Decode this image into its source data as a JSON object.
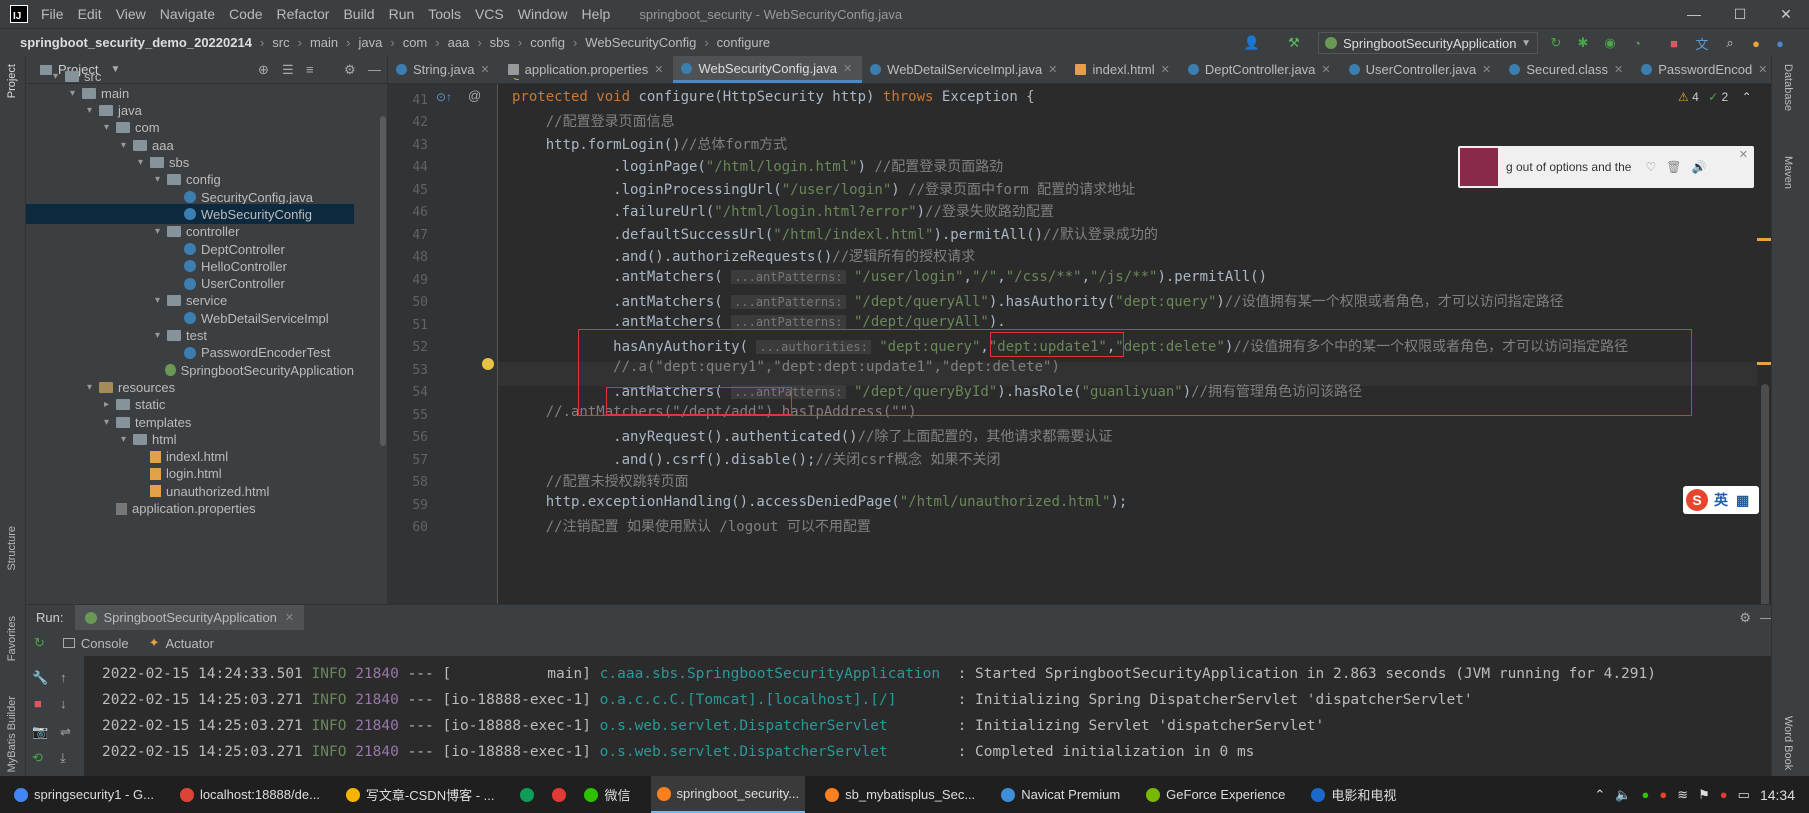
{
  "titlebar": {
    "logo": "IJ",
    "menu": [
      "File",
      "Edit",
      "View",
      "Navigate",
      "Code",
      "Refactor",
      "Build",
      "Run",
      "Tools",
      "VCS",
      "Window",
      "Help"
    ],
    "title": "springboot_security - WebSecurityConfig.java"
  },
  "breadcrumbs": [
    "springboot_security_demo_20220214",
    "src",
    "main",
    "java",
    "com",
    "aaa",
    "sbs",
    "config",
    "WebSecurityConfig",
    "configure"
  ],
  "run_config": "SpringbootSecurityApplication",
  "project_panel": {
    "title": "Project",
    "tree": [
      {
        "label": "src",
        "depth": 1,
        "type": "folder",
        "open": true
      },
      {
        "label": "main",
        "depth": 2,
        "type": "folder",
        "open": true
      },
      {
        "label": "java",
        "depth": 3,
        "type": "folder",
        "open": true
      },
      {
        "label": "com",
        "depth": 4,
        "type": "folder",
        "open": true
      },
      {
        "label": "aaa",
        "depth": 5,
        "type": "folder",
        "open": true
      },
      {
        "label": "sbs",
        "depth": 6,
        "type": "folder",
        "open": true
      },
      {
        "label": "config",
        "depth": 7,
        "type": "folder",
        "open": true
      },
      {
        "label": "SecurityConfig.java",
        "depth": 8,
        "type": "java"
      },
      {
        "label": "WebSecurityConfig",
        "depth": 8,
        "type": "java",
        "selected": true
      },
      {
        "label": "controller",
        "depth": 7,
        "type": "folder",
        "open": true
      },
      {
        "label": "DeptController",
        "depth": 8,
        "type": "java"
      },
      {
        "label": "HelloController",
        "depth": 8,
        "type": "java"
      },
      {
        "label": "UserController",
        "depth": 8,
        "type": "java"
      },
      {
        "label": "service",
        "depth": 7,
        "type": "folder",
        "open": true
      },
      {
        "label": "WebDetailServiceImpl",
        "depth": 8,
        "type": "java"
      },
      {
        "label": "test",
        "depth": 7,
        "type": "folder",
        "open": true
      },
      {
        "label": "PasswordEncoderTest",
        "depth": 8,
        "type": "java"
      },
      {
        "label": "SpringbootSecurityApplication",
        "depth": 7,
        "type": "spring"
      },
      {
        "label": "resources",
        "depth": 3,
        "type": "res",
        "open": true
      },
      {
        "label": "static",
        "depth": 4,
        "type": "folder"
      },
      {
        "label": "templates",
        "depth": 4,
        "type": "folder",
        "open": true
      },
      {
        "label": "html",
        "depth": 5,
        "type": "folder",
        "open": true
      },
      {
        "label": "indexl.html",
        "depth": 6,
        "type": "html"
      },
      {
        "label": "login.html",
        "depth": 6,
        "type": "html"
      },
      {
        "label": "unauthorized.html",
        "depth": 6,
        "type": "html"
      },
      {
        "label": "application.properties",
        "depth": 4,
        "type": "prop"
      }
    ]
  },
  "tabs": [
    {
      "label": "String.java",
      "icon": "java"
    },
    {
      "label": "application.properties",
      "icon": "prop"
    },
    {
      "label": "WebSecurityConfig.java",
      "icon": "java",
      "active": true
    },
    {
      "label": "WebDetailServiceImpl.java",
      "icon": "java"
    },
    {
      "label": "indexl.html",
      "icon": "html"
    },
    {
      "label": "DeptController.java",
      "icon": "java"
    },
    {
      "label": "UserController.java",
      "icon": "java"
    },
    {
      "label": "Secured.class",
      "icon": "java"
    },
    {
      "label": "PasswordEncod",
      "icon": "java"
    }
  ],
  "inspections": {
    "warnings": "4",
    "weak": "2"
  },
  "code_lines": [
    {
      "n": "",
      "html": "<span class=\"ann\">@Override</span>"
    },
    {
      "n": "41",
      "html": "<span class=\"kw\">protected void</span> configure(HttpSecurity http) <span class=\"kw\">throws</span> Exception {"
    },
    {
      "n": "42",
      "html": "    <span class=\"cm\">//配置登录页面信息</span>"
    },
    {
      "n": "43",
      "html": "    http.formLogin()<span class=\"cm\">//总体form方式</span>"
    },
    {
      "n": "44",
      "html": "            .loginPage(<span class=\"str\">\"/html/login.html\"</span>) <span class=\"cm\">//配置登录页面路劲</span>"
    },
    {
      "n": "45",
      "html": "            .loginProcessingUrl(<span class=\"str\">\"/user/login\"</span>) <span class=\"cm\">//登录页面中form 配置的请求地址</span>"
    },
    {
      "n": "46",
      "html": "            .failureUrl(<span class=\"str\">\"/html/login.html?error\"</span>)<span class=\"cm\">//登录失败路劲配置</span>"
    },
    {
      "n": "47",
      "html": "            .defaultSuccessUrl(<span class=\"str\">\"/html/indexl.html\"</span>).permitAll()<span class=\"cm\">//默认登录成功的</span>"
    },
    {
      "n": "48",
      "html": "            .and().authorizeRequests()<span class=\"cm\">//逻辑所有的授权请求</span>"
    },
    {
      "n": "49",
      "html": "            .antMatchers( <span class=\"hint\">...antPatterns:</span> <span class=\"str\">\"/user/login\"</span>,<span class=\"str\">\"/\"</span>,<span class=\"str\">\"/css/**\"</span>,<span class=\"str\">\"/js/**\"</span>).permitAll()"
    },
    {
      "n": "50",
      "html": "            .antMatchers( <span class=\"hint\">...antPatterns:</span> <span class=\"str\">\"/dept/queryAll\"</span>).hasAuthority(<span class=\"str\">\"dept:query\"</span>)<span class=\"cm\">//设值拥有某一个权限或者角色，才可以访问指定路径</span>"
    },
    {
      "n": "51",
      "html": "            .antMatchers( <span class=\"hint\">...antPatterns:</span> <span class=\"str\">\"/dept/queryAll\"</span>)."
    },
    {
      "n": "52",
      "html": "            hasAnyAuthority( <span class=\"hint\">...authorities:</span> <span class=\"str\">\"dept:query\"</span>,<span class=\"str\">\"dept:update1\"</span>,<span class=\"str\">\"dept:delete\"</span>)<span class=\"cm\">//设值拥有多个中的某一个权限或者角色，才可以访问指定路径</span>"
    },
    {
      "n": "53",
      "html": "            <span class=\"cm\">//.a(\"dept:query1\",\"dept:dept:update1\",\"dept:delete\")</span>"
    },
    {
      "n": "54",
      "html": "            .antMatchers( <span class=\"hint\">...antPatterns:</span> <span class=\"str\">\"/dept/queryById\"</span>).hasRole(<span class=\"str\">\"guanliyuan\"</span>)<span class=\"cm\">//拥有管理角色访问该路径</span>"
    },
    {
      "n": "55",
      "html": "    <span class=\"cm\">//.antMatchers(\"/dept/add\").hasIpAddress(\"\")</span>"
    },
    {
      "n": "56",
      "html": "            .anyRequest().authenticated()<span class=\"cm\">//除了上面配置的，其他请求都需要认证</span>"
    },
    {
      "n": "57",
      "html": "            .and().csrf().disable();<span class=\"cm\">//关闭csrf概念 如果不关闭</span>"
    },
    {
      "n": "58",
      "html": "    <span class=\"cm\">//配置未授权跳转页面</span>"
    },
    {
      "n": "59",
      "html": "    http.exceptionHandling().accessDeniedPage(<span class=\"str\">\"/html/unauthorized.html\"</span>);"
    },
    {
      "n": "60",
      "html": "    <span class=\"cm\">//注销配置 如果使用默认 /logout 可以不用配置</span>"
    }
  ],
  "run_panel": {
    "label": "Run:",
    "app": "SpringbootSecurityApplication",
    "console_tab": "Console",
    "actuator_tab": "Actuator"
  },
  "logs": [
    {
      "ts": "2022-02-15 14:24:33.501",
      "level": "INFO",
      "pid": "21840",
      "sep": "---",
      "thread": "[           main]",
      "logger": "c.aaa.sbs.SpringbootSecurityApplication ",
      "msg": ": Started SpringbootSecurityApplication in 2.863 seconds (JVM running for 4.291)"
    },
    {
      "ts": "2022-02-15 14:25:03.271",
      "level": "INFO",
      "pid": "21840",
      "sep": "---",
      "thread": "[io-18888-exec-1]",
      "logger": "o.a.c.c.C.[Tomcat].[localhost].[/]      ",
      "msg": ": Initializing Spring DispatcherServlet 'dispatcherServlet'"
    },
    {
      "ts": "2022-02-15 14:25:03.271",
      "level": "INFO",
      "pid": "21840",
      "sep": "---",
      "thread": "[io-18888-exec-1]",
      "logger": "o.s.web.servlet.DispatcherServlet       ",
      "msg": ": Initializing Servlet 'dispatcherServlet'"
    },
    {
      "ts": "2022-02-15 14:25:03.271",
      "level": "INFO",
      "pid": "21840",
      "sep": "---",
      "thread": "[io-18888-exec-1]",
      "logger": "o.s.web.servlet.DispatcherServlet       ",
      "msg": ": Completed initialization in 0 ms"
    }
  ],
  "left_strip": [
    "Project",
    "Structure",
    "Favorites",
    "MyBatis Builder"
  ],
  "right_strip": [
    "Database",
    "Maven",
    "Word Book"
  ],
  "music_popup": {
    "text": "g out of options and the"
  },
  "ime": {
    "label": "英"
  },
  "taskbar": {
    "items": [
      {
        "label": "springsecurity1 - G...",
        "color": "#4285f4"
      },
      {
        "label": "localhost:18888/de...",
        "color": "#db4437"
      },
      {
        "label": "写文章-CSDN博客 - ...",
        "color": "#f4b400"
      },
      {
        "label": "",
        "color": "#0f9d58"
      },
      {
        "label": "",
        "color": "#e53935"
      },
      {
        "label": "微信",
        "color": "#2dc100"
      },
      {
        "label": "springboot_security...",
        "color": "#fc801d",
        "active": true
      },
      {
        "label": "sb_mybatisplus_Sec...",
        "color": "#fc801d"
      },
      {
        "label": "Navicat Premium",
        "color": "#3e8fd8"
      },
      {
        "label": "GeForce Experience",
        "color": "#76b900"
      },
      {
        "label": "电影和电视",
        "color": "#1b6ac9"
      }
    ],
    "clock": "14:34"
  }
}
